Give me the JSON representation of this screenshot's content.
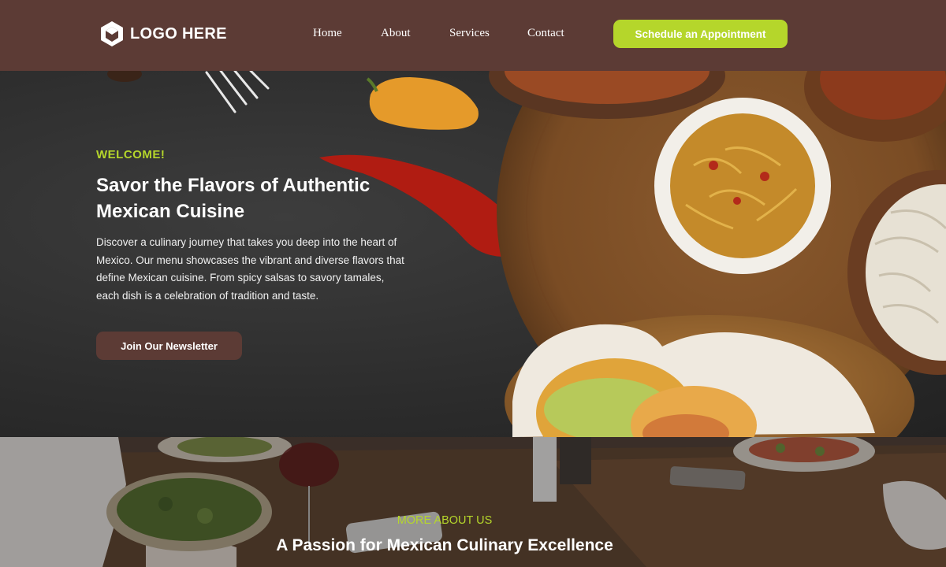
{
  "header": {
    "logo_text": "LOGO HERE",
    "nav": [
      "Home",
      "About",
      "Services",
      "Contact"
    ],
    "cta_label": "Schedule an Appointment"
  },
  "hero": {
    "eyebrow": "WELCOME!",
    "title": "Savor the Flavors of Authentic Mexican Cuisine",
    "description": "Discover a culinary journey that takes you deep into the heart of Mexico. Our menu showcases the vibrant and diverse flavors that define Mexican cuisine. From spicy salsas to savory tamales, each dish is a celebration of tradition and taste.",
    "button_label": "Join Our Newsletter"
  },
  "about": {
    "eyebrow": "MORE ABOUT US",
    "title": "A Passion for Mexican Culinary Excellence"
  },
  "colors": {
    "header_bg": "#5c3b35",
    "accent": "#b5d62b",
    "button_bg": "#5c3b35",
    "text": "#ffffff"
  }
}
